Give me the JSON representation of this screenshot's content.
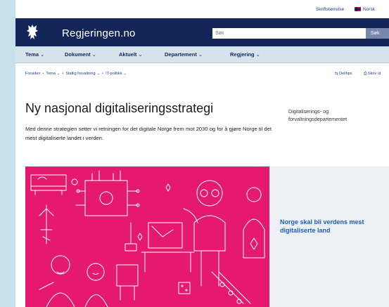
{
  "utility": {
    "privacy_label": "Skriftstørrelse",
    "language_label": "Norsk"
  },
  "header": {
    "site_title": "Regjeringen.no",
    "search_placeholder": "Søk",
    "search_button": "Søk"
  },
  "nav": {
    "items": [
      {
        "label": "Tema"
      },
      {
        "label": "Dokument"
      },
      {
        "label": "Aktuelt"
      },
      {
        "label": "Departement"
      },
      {
        "label": "Regjering"
      }
    ]
  },
  "breadcrumb": {
    "items": [
      "Forsiden",
      "Tema",
      "Statlig forvaltning",
      "IT-politikk"
    ]
  },
  "tools": {
    "share_label": "Del/tips",
    "print_label": "Skriv ut"
  },
  "article": {
    "title": "Ny nasjonal digitaliseringsstrategi",
    "lead": "Med denne strategien setter vi retningen for det digitale Norge frem mot 2030 og for å gjøre Norge til det mest digitaliserte landet i verden.",
    "ministry": "Digitaliserings- og forvaltningsdepartementet"
  },
  "hero": {
    "caption": "Norge skal bli verdens mest digitaliserte land"
  },
  "colors": {
    "header_bg": "#13265a",
    "nav_bg": "#d7e3ec",
    "hero_pink": "#e5196d",
    "link_blue": "#1a5fbf"
  }
}
